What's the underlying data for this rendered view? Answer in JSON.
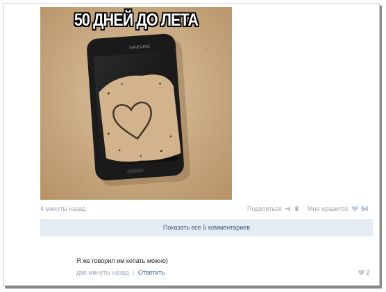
{
  "post": {
    "image_caption": "50 ДНЕЙ ДО ЛЕТА",
    "phone_brand": "SAMSUNG",
    "time": "4 минуты назад",
    "share_label": "Поделиться",
    "share_count": "8",
    "like_label": "Мне нравится",
    "like_count": "54",
    "show_comments_label": "Показать все 5 комментариев"
  },
  "comment": {
    "text": "Я же говорил им копать можно)",
    "time": "две минуты назад",
    "separator": "|",
    "reply_label": "Ответить",
    "like_count": "2"
  },
  "icons": {
    "share": "megaphone-icon",
    "like": "heart-icon",
    "comment_like": "heart-icon"
  },
  "colors": {
    "accent_link": "#3e6494",
    "meta_text": "#9aa6b5",
    "button_bg": "#e6ecf3",
    "sand": "#c9aa83"
  }
}
